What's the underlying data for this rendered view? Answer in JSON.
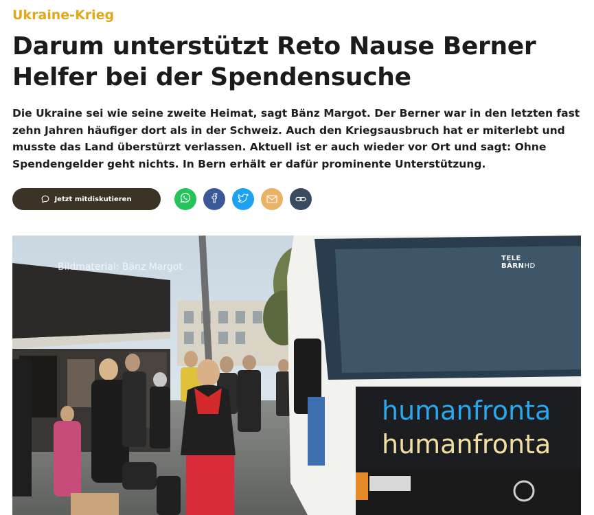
{
  "article": {
    "kicker": "Ukraine-Krieg",
    "headline": "Darum unterstützt Reto Nause Berner Helfer bei der Spendensuche",
    "lead": "Die Ukraine sei wie seine zweite Heimat, sagt Bänz Margot. Der Berner war in den letzten fast zehn Jahren häufiger dort als in der Schweiz. Auch den Kriegsausbruch hat er miterlebt und musste das Land überstürzt verlassen. Aktuell ist er auch wieder vor Ort und sagt: Ohne Spendengelder geht nichts. In Bern erhält er dafür prominente Unterstützung."
  },
  "actions": {
    "discuss_label": "Jetzt mitdiskutieren",
    "share": [
      {
        "name": "whatsapp",
        "icon": "whatsapp-icon",
        "color": "#25c45a"
      },
      {
        "name": "facebook",
        "icon": "facebook-icon",
        "color": "#3b5998"
      },
      {
        "name": "twitter",
        "icon": "twitter-icon",
        "color": "#1da1f2"
      },
      {
        "name": "email",
        "icon": "mail-icon",
        "color": "#e9b267"
      },
      {
        "name": "copy-link",
        "icon": "link-icon",
        "color": "#3a4a60"
      }
    ]
  },
  "video": {
    "watermark": "Bildmaterial: Bänz Margot",
    "logo_line1": "TELE",
    "logo_line2": "BÄRN",
    "logo_hd": "HD",
    "bus_text_1": "humanfronta",
    "bus_text_2": "humanfronta"
  },
  "colors": {
    "kicker": "#e0a81b",
    "discuss_bg": "#3b3326"
  }
}
